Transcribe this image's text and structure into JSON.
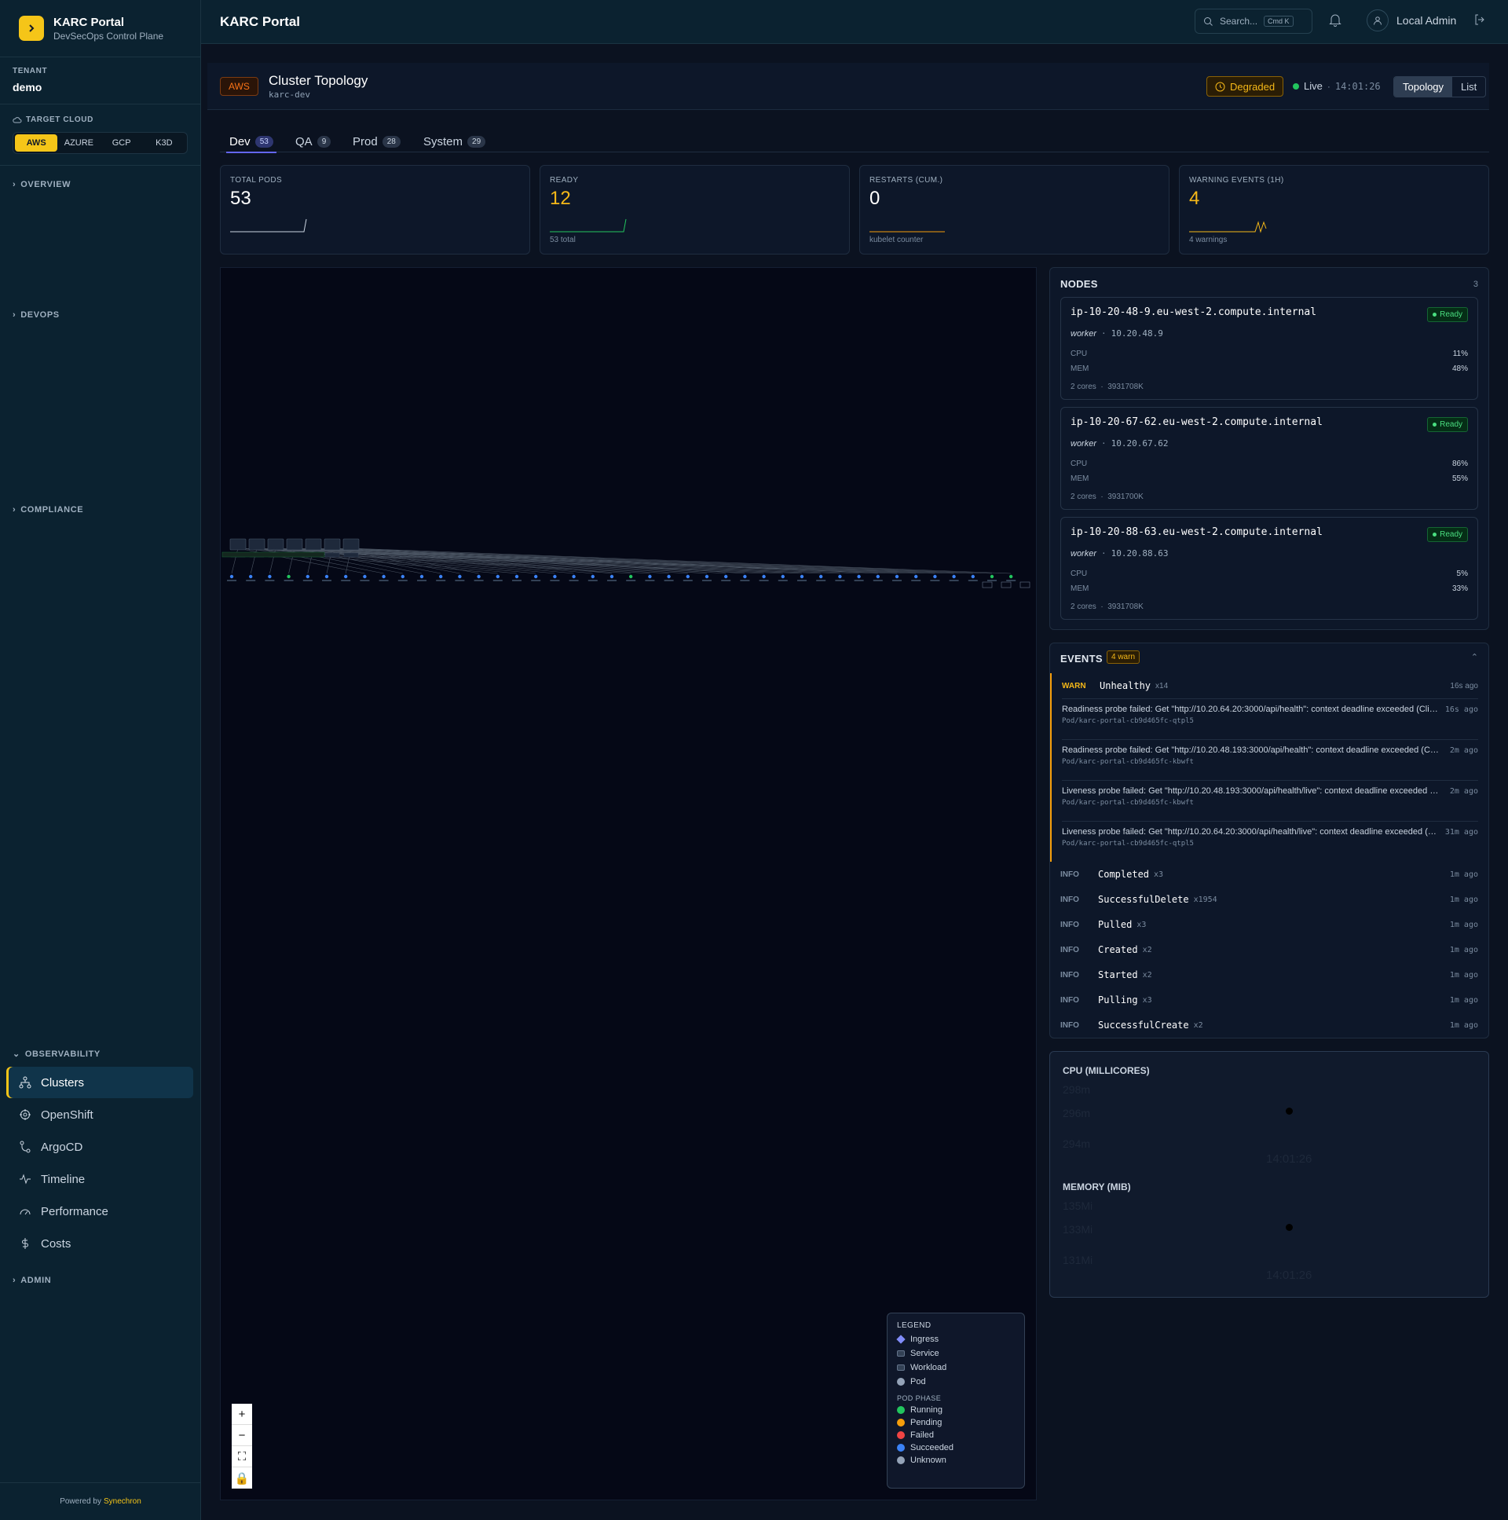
{
  "brand": {
    "title": "KARC Portal",
    "subtitle": "DevSecOps Control Plane",
    "logo_icon": "chevron-right-icon"
  },
  "tenant": {
    "label": "TENANT",
    "value": "demo"
  },
  "target_cloud": {
    "label": "TARGET CLOUD",
    "options": [
      "AWS",
      "AZURE",
      "GCP",
      "K3D"
    ],
    "selected": "AWS"
  },
  "nav": {
    "sections": [
      "OVERVIEW",
      "DEVOPS",
      "COMPLIANCE",
      "OBSERVABILITY",
      "ADMIN"
    ],
    "items": [
      {
        "label": "Clusters",
        "icon": "network-icon",
        "active": true
      },
      {
        "label": "OpenShift",
        "icon": "openshift-icon"
      },
      {
        "label": "ArgoCD",
        "icon": "git-branch-icon"
      },
      {
        "label": "Timeline",
        "icon": "activity-icon"
      },
      {
        "label": "Performance",
        "icon": "gauge-icon"
      },
      {
        "label": "Costs",
        "icon": "dollar-icon"
      }
    ]
  },
  "footer": {
    "prefix": "Powered by",
    "brand": "Synechron"
  },
  "topbar": {
    "title": "KARC Portal",
    "search_placeholder": "Search...",
    "search_kbd": "Cmd K",
    "user": "Local Admin"
  },
  "header": {
    "cloud_badge": "AWS",
    "title": "Cluster Topology",
    "cluster": "karc-dev",
    "status": "Degraded",
    "live": "Live",
    "time": "14:01:26",
    "views": [
      "Topology",
      "List"
    ],
    "selected_view": "Topology"
  },
  "tabs": [
    {
      "label": "Dev",
      "count": "53",
      "active": true
    },
    {
      "label": "QA",
      "count": "9"
    },
    {
      "label": "Prod",
      "count": "28"
    },
    {
      "label": "System",
      "count": "29"
    }
  ],
  "metrics": [
    {
      "label": "TOTAL PODS",
      "value": "53",
      "note": ""
    },
    {
      "label": "READY",
      "value": "12",
      "note": "53 total"
    },
    {
      "label": "RESTARTS (CUM.)",
      "value": "0",
      "note": "kubelet counter"
    },
    {
      "label": "WARNING EVENTS (1H)",
      "value": "4",
      "note": "4 warnings"
    }
  ],
  "legend": {
    "title": "LEGEND",
    "kinds": [
      "Ingress",
      "Service",
      "Workload",
      "Pod"
    ],
    "phase_title": "POD PHASE",
    "phases": [
      {
        "label": "Running",
        "color": "#22c55e"
      },
      {
        "label": "Pending",
        "color": "#f59e0b"
      },
      {
        "label": "Failed",
        "color": "#ef4444"
      },
      {
        "label": "Succeeded",
        "color": "#3b82f6"
      },
      {
        "label": "Unknown",
        "color": "#94a3b8"
      }
    ]
  },
  "nodes": {
    "title": "NODES",
    "count": "3",
    "items": [
      {
        "name": "ip-10-20-48-9.eu-west-2.compute.internal",
        "status": "Ready",
        "role": "worker",
        "ip": "10.20.48.9",
        "cpu": "11%",
        "mem": "48%",
        "cores": "2 cores",
        "memory": "3931708K"
      },
      {
        "name": "ip-10-20-67-62.eu-west-2.compute.internal",
        "status": "Ready",
        "role": "worker",
        "ip": "10.20.67.62",
        "cpu": "86%",
        "mem": "55%",
        "cores": "2 cores",
        "memory": "3931700K"
      },
      {
        "name": "ip-10-20-88-63.eu-west-2.compute.internal",
        "status": "Ready",
        "role": "worker",
        "ip": "10.20.88.63",
        "cpu": "5%",
        "mem": "33%",
        "cores": "2 cores",
        "memory": "3931708K"
      }
    ],
    "cpu_label": "CPU",
    "mem_label": "MEM"
  },
  "events": {
    "title": "EVENTS",
    "warn_badge": "4 warn",
    "warn": {
      "level": "WARN",
      "reason": "Unhealthy",
      "count": "x14",
      "time": "16s ago",
      "details": [
        {
          "message": "Readiness probe failed: Get \"http://10.20.64.20:3000/api/health\": context deadline exceeded (Client.Timeout exceeded while awaiting headers)",
          "object": "Pod/karc-portal-cb9d465fc-qtpl5",
          "time": "16s ago"
        },
        {
          "message": "Readiness probe failed: Get \"http://10.20.48.193:3000/api/health\": context deadline exceeded (Client.Timeout exceeded while awaiting headers)",
          "object": "Pod/karc-portal-cb9d465fc-kbwft",
          "time": "2m ago"
        },
        {
          "message": "Liveness probe failed: Get \"http://10.20.48.193:3000/api/health/live\": context deadline exceeded (Client.Timeout exceeded while awaiting headers)",
          "object": "Pod/karc-portal-cb9d465fc-kbwft",
          "time": "2m ago"
        },
        {
          "message": "Liveness probe failed: Get \"http://10.20.64.20:3000/api/health/live\": context deadline exceeded (Client.Timeout exceeded while awaiting headers)",
          "object": "Pod/karc-portal-cb9d465fc-qtpl5",
          "time": "31m ago"
        }
      ]
    },
    "info": [
      {
        "level": "INFO",
        "reason": "Completed",
        "count": "x3",
        "time": "1m ago"
      },
      {
        "level": "INFO",
        "reason": "SuccessfulDelete",
        "count": "x1954",
        "time": "1m ago"
      },
      {
        "level": "INFO",
        "reason": "Pulled",
        "count": "x3",
        "time": "1m ago"
      },
      {
        "level": "INFO",
        "reason": "Created",
        "count": "x2",
        "time": "1m ago"
      },
      {
        "level": "INFO",
        "reason": "Started",
        "count": "x2",
        "time": "1m ago"
      },
      {
        "level": "INFO",
        "reason": "Pulling",
        "count": "x3",
        "time": "1m ago"
      },
      {
        "level": "INFO",
        "reason": "SuccessfulCreate",
        "count": "x2",
        "time": "1m ago"
      }
    ]
  },
  "charts": {
    "cpu": {
      "title": "CPU (MILLICORES)",
      "ticks": [
        "298m",
        "296m",
        "294m"
      ],
      "x": "14:01:26"
    },
    "mem": {
      "title": "MEMORY (MIB)",
      "ticks": [
        "135Mi",
        "133Mi",
        "131Mi"
      ],
      "x": "14:01:26"
    }
  },
  "chart_data": [
    {
      "type": "scatter",
      "title": "CPU (MILLICORES)",
      "x": [
        "14:01:26"
      ],
      "series": [
        {
          "values": [
            296
          ]
        }
      ],
      "ylim": [
        293,
        299
      ]
    },
    {
      "type": "scatter",
      "title": "MEMORY (MIB)",
      "x": [
        "14:01:26"
      ],
      "series": [
        {
          "values": [
            133
          ]
        }
      ],
      "ylim": [
        130,
        136
      ]
    }
  ]
}
